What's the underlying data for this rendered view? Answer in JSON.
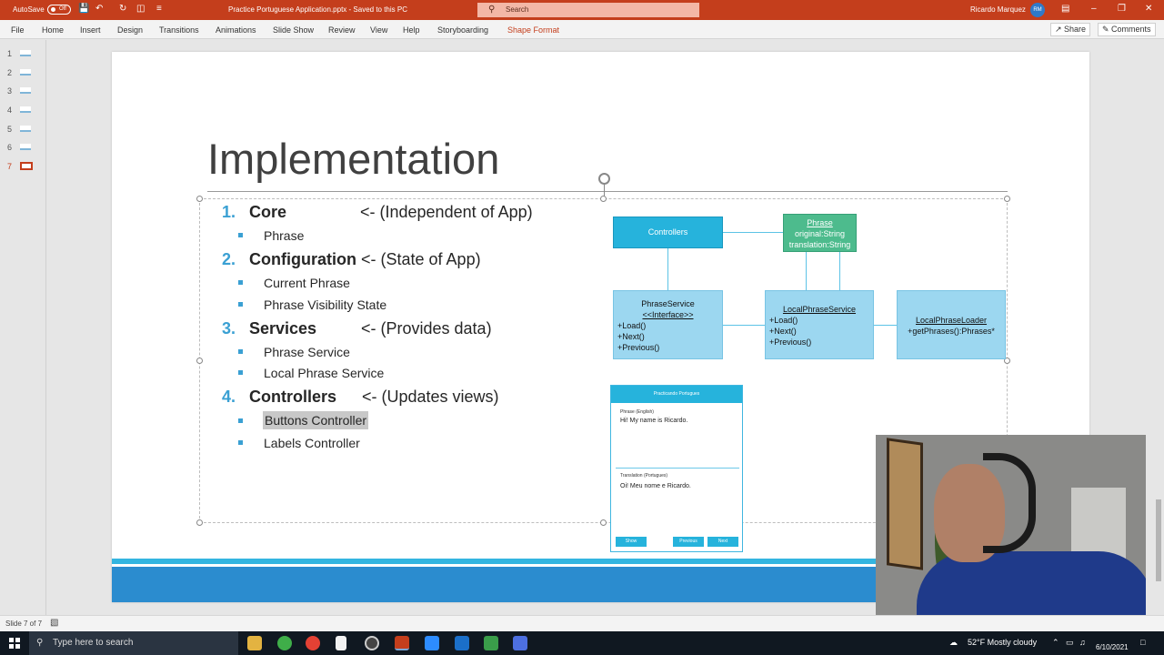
{
  "titlebar": {
    "autosave": "AutoSave",
    "toggle": "Off",
    "document": "Practice Portuguese Application.pptx  -  Saved to this PC",
    "search_placeholder": "Search",
    "user": "Ricardo Marquez",
    "initials": "RM"
  },
  "ribbon": {
    "tabs": [
      "File",
      "Home",
      "Insert",
      "Design",
      "Transitions",
      "Animations",
      "Slide Show",
      "Review",
      "View",
      "Help",
      "Storyboarding",
      "Shape Format"
    ],
    "share": "Share",
    "comments": "Comments"
  },
  "thumbnails": [
    "1",
    "2",
    "3",
    "4",
    "5",
    "6",
    "7"
  ],
  "slide": {
    "title": "Implementation",
    "items": [
      {
        "num": "1.",
        "head": "Core",
        "note": "<- (Independent of App)",
        "subs": [
          "Phrase"
        ]
      },
      {
        "num": "2.",
        "head": "Configuration",
        "note": "<- (State of App)",
        "subs": [
          "Current Phrase",
          "Phrase Visibility State"
        ]
      },
      {
        "num": "3.",
        "head": "Services",
        "note": "<- (Provides data)",
        "subs": [
          "Phrase Service",
          "Local Phrase Service"
        ]
      },
      {
        "num": "4.",
        "head": "Controllers",
        "note": "<- (Updates views)",
        "subs": [
          "Buttons Controller",
          "Labels Controller"
        ]
      }
    ],
    "uml": {
      "controllers": "Controllers",
      "phrase": {
        "name": "Phrase",
        "attr1": "original:String",
        "attr2": "translation:String"
      },
      "phrase_service": {
        "name": "PhraseService",
        "stereo": "<<Interface>>",
        "m1": "+Load()",
        "m2": "+Next()",
        "m3": "+Previous()"
      },
      "local_phrase_service": {
        "name": "LocalPhraseService",
        "m1": "+Load()",
        "m2": "+Next()",
        "m3": "+Previous()"
      },
      "local_phrase_loader": {
        "name": "LocalPhraseLoader",
        "m1": "+getPhrases():Phrases*"
      }
    },
    "mockup": {
      "title": "Practicando Portugues",
      "label1": "Phrase (English)",
      "value1": "Hi! My name is Ricardo.",
      "label2": "Translation (Portugues)",
      "value2": "Oi! Meu nome e Ricardo.",
      "btn_show": "Show",
      "btn_prev": "Previous",
      "btn_next": "Next"
    }
  },
  "status": {
    "slide": "Slide 7 of 7"
  },
  "taskbar": {
    "search_placeholder": "Type here to search",
    "weather": "52°F  Mostly cloudy",
    "date": "6/10/2021"
  },
  "colors": {
    "accent": "#c43e1c",
    "bullet": "#3aa0d3",
    "band": "#2b8ccf"
  }
}
